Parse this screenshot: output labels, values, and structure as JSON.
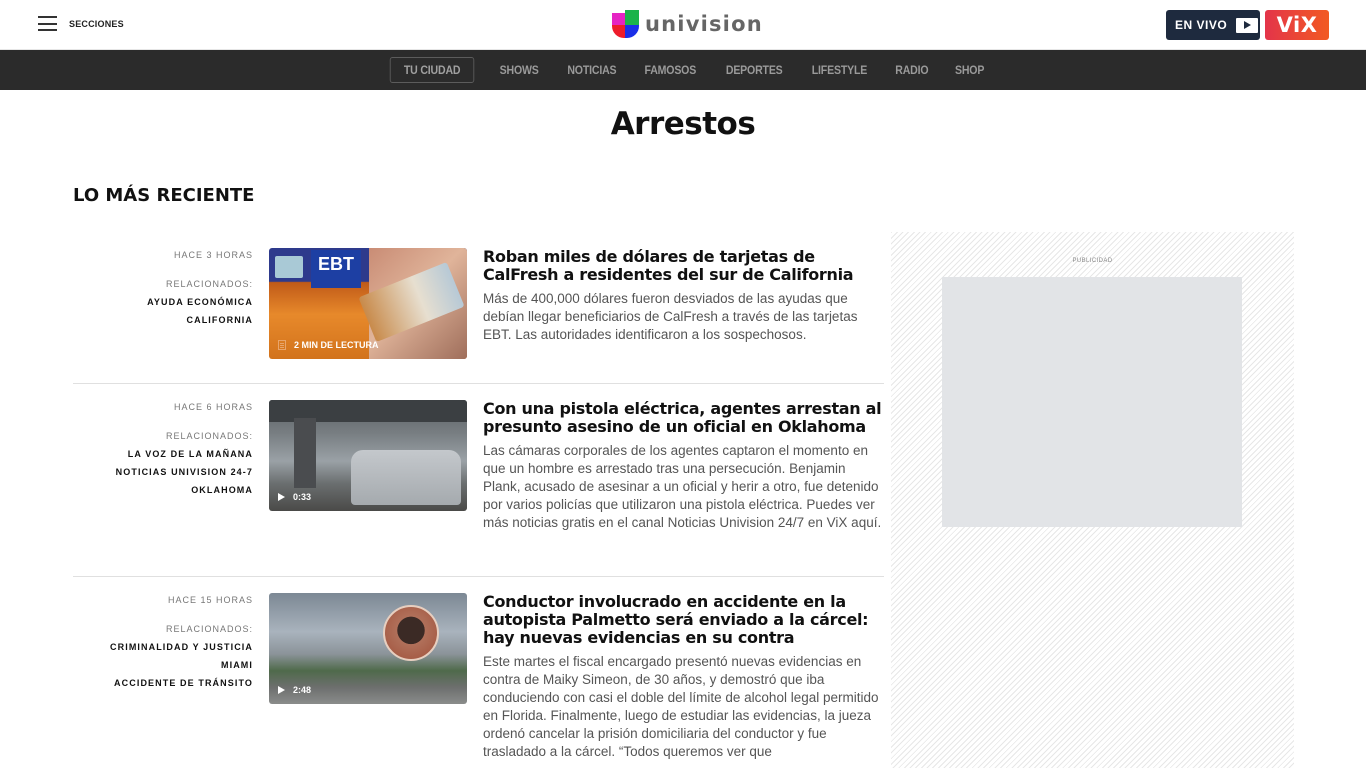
{
  "header": {
    "menu_label": "SECCIONES",
    "logo_text": "univision",
    "envivo_label": "EN VIVO",
    "vix_label": "ViX"
  },
  "nav": {
    "items": [
      "TU CIUDAD",
      "SHOWS",
      "NOTICIAS",
      "FAMOSOS",
      "DEPORTES",
      "LIFESTYLE",
      "RADIO",
      "SHOP"
    ]
  },
  "page": {
    "title": "Arrestos",
    "section_title": "LO MÁS RECIENTE"
  },
  "articles": [
    {
      "time": "HACE 3 HORAS",
      "related_label": "RELACIONADOS:",
      "tags": [
        "AYUDA ECONÓMICA",
        "CALIFORNIA"
      ],
      "media_type": "article",
      "media_badge": "2 MIN DE LECTURA",
      "headline": "Roban miles de dólares de tarjetas de CalFresh a residentes del sur de California",
      "summary": "Más de 400,000 dólares fueron desviados de las ayudas que debían llegar beneficiarios de CalFresh a través de las tarjetas EBT. Las autoridades identificaron a los sospechosos."
    },
    {
      "time": "HACE 6 HORAS",
      "related_label": "RELACIONADOS:",
      "tags": [
        "LA VOZ DE LA MAÑANA",
        "NOTICIAS UNIVISION 24-7",
        "OKLAHOMA"
      ],
      "media_type": "video",
      "media_badge": "0:33",
      "headline": "Con una pistola eléctrica, agentes arrestan al presunto asesino de un oficial en Oklahoma",
      "summary": "Las cámaras corporales de los agentes captaron el momento en que un hombre es arrestado tras una persecución. Benjamin Plank, acusado de asesinar a un oficial y herir a otro, fue detenido por varios policías que utilizaron una pistola eléctrica. Puedes ver más noticias gratis en el canal Noticias Univision 24/7 en ViX aquí."
    },
    {
      "time": "HACE 15 HORAS",
      "related_label": "RELACIONADOS:",
      "tags": [
        "CRIMINALIDAD Y JUSTICIA",
        "MIAMI",
        "ACCIDENTE DE TRÁNSITO"
      ],
      "media_type": "video",
      "media_badge": "2:48",
      "headline": "Conductor involucrado en accidente en la autopista Palmetto será enviado a la cárcel: hay nuevas evidencias en su contra",
      "summary": "Este martes el fiscal encargado presentó nuevas evidencias en contra de Maiky Simeon, de 30 años, y demostró que iba conduciendo con casi el doble del límite de alcohol legal permitido en Florida. Finalmente, luego de estudiar las evidencias, la jueza ordenó cancelar la prisión domiciliaria del conductor y fue trasladado a la cárcel. “Todos queremos ver que"
    }
  ],
  "ad": {
    "label": "PUBLICIDAD"
  }
}
